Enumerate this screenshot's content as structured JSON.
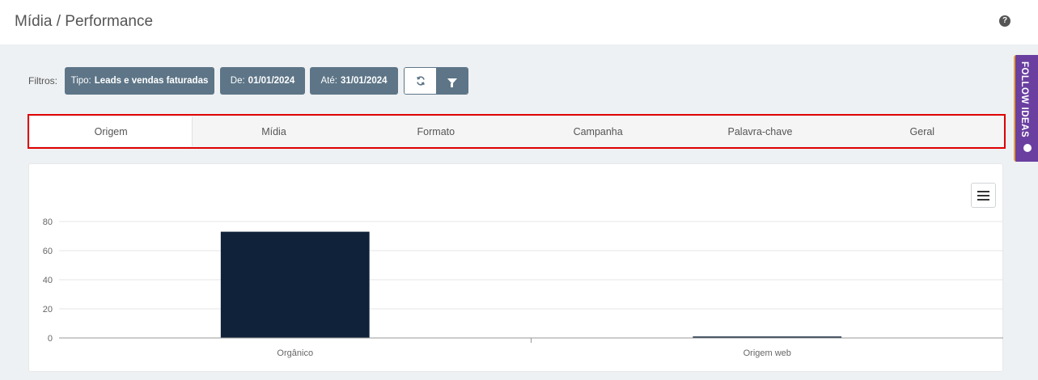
{
  "header": {
    "title": "Mídia / Performance",
    "help_icon": "question-circle-icon"
  },
  "filters": {
    "label": "Filtros:",
    "tipo_label": "Tipo:",
    "tipo_value": "Leads e vendas faturadas",
    "de_label": "De:",
    "de_value": "01/01/2024",
    "ate_label": "Até:",
    "ate_value": "31/01/2024",
    "refresh_icon": "refresh-icon",
    "filter_icon": "funnel-icon"
  },
  "tabs": [
    {
      "label": "Origem",
      "active": true
    },
    {
      "label": "Mídia",
      "active": false
    },
    {
      "label": "Formato",
      "active": false
    },
    {
      "label": "Campanha",
      "active": false
    },
    {
      "label": "Palavra-chave",
      "active": false
    },
    {
      "label": "Geral",
      "active": false
    }
  ],
  "side_tab": {
    "label": "FOLLOW IDEAS",
    "color": "#6a3fa0"
  },
  "chart_menu_icon": "hamburger-menu-icon",
  "colors": {
    "filter_button": "#5d7587",
    "bar": "#10223a",
    "highlight_outline": "#e00000"
  },
  "chart_data": {
    "type": "bar",
    "categories": [
      "Orgânico",
      "Origem web"
    ],
    "values": [
      73,
      1
    ],
    "ylim": [
      0,
      80
    ],
    "yticks": [
      0,
      20,
      40,
      60,
      80
    ],
    "grid": true
  }
}
